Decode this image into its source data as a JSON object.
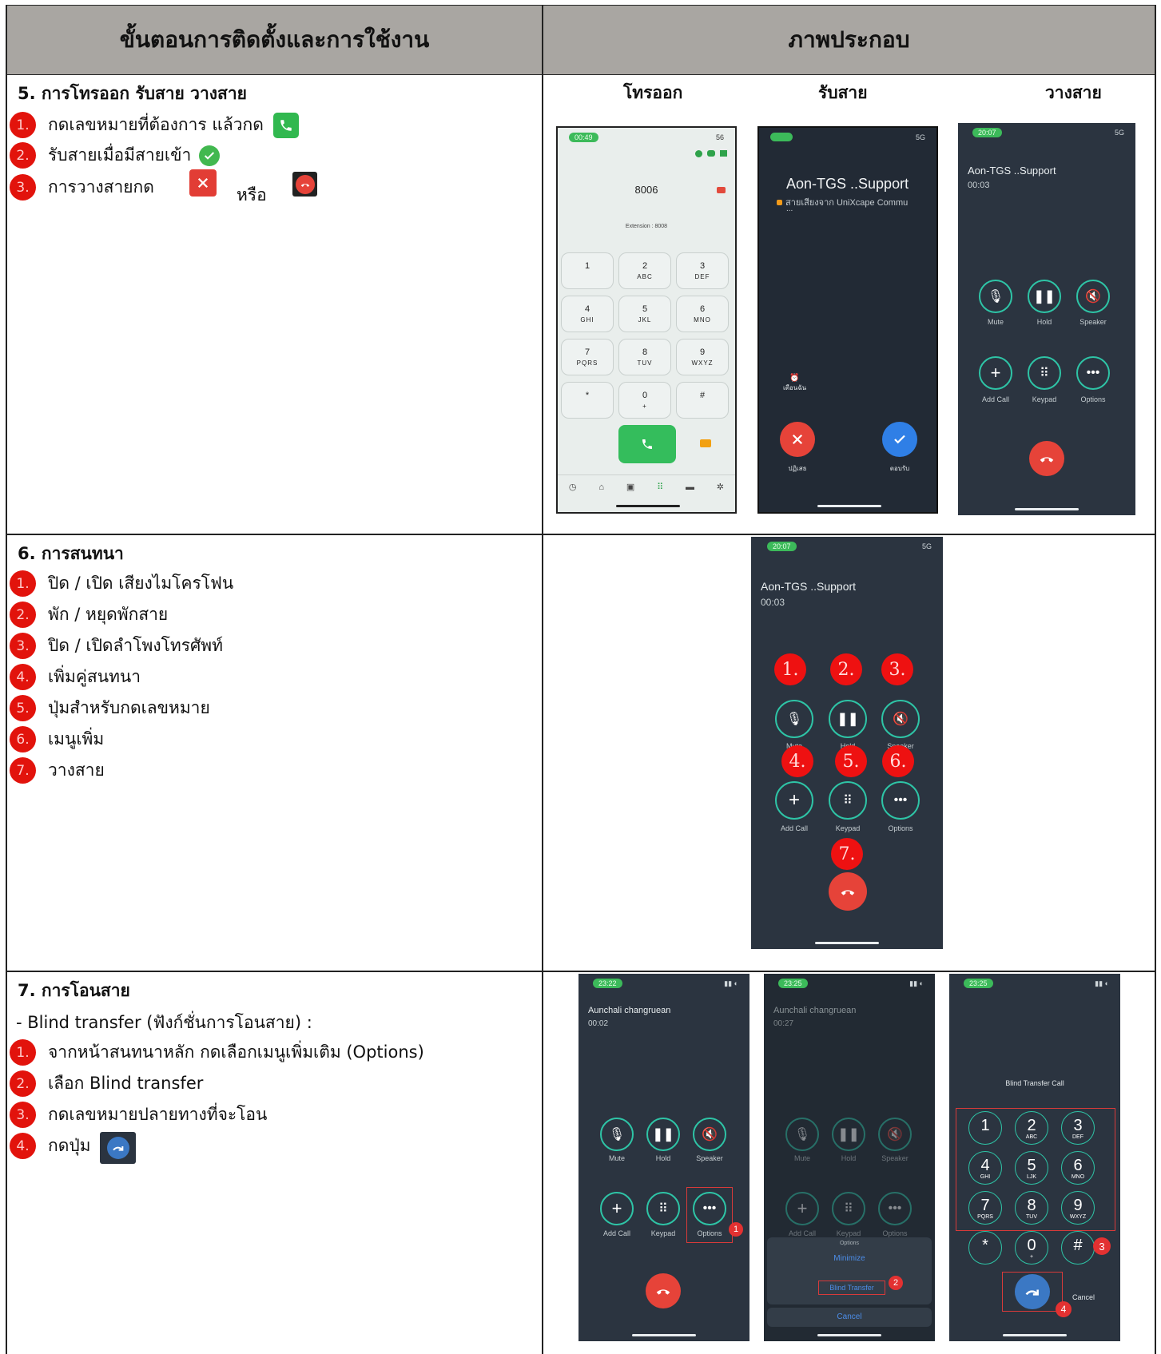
{
  "header": {
    "left": "ขั้นตอนการติดตั้งและการใช้งาน",
    "right": "ภาพประกอบ"
  },
  "section5": {
    "title": "5. การโทรออก รับสาย วางสาย",
    "steps": [
      "กดเลขหมายที่ต้องการ แล้วกด",
      "รับสายเมื่อมีสายเข้า",
      "การวางสายกด"
    ],
    "or": "หรือ",
    "nums": [
      "1.",
      "2.",
      "3."
    ],
    "captions": [
      "โทรออก",
      "รับสาย",
      "วางสาย"
    ],
    "dialer": {
      "time": "00:49",
      "signal": "56",
      "number": "8006",
      "extension": "Extension : 8008",
      "keys": [
        {
          "d": "1",
          "l": ""
        },
        {
          "d": "2",
          "l": "ABC"
        },
        {
          "d": "3",
          "l": "DEF"
        },
        {
          "d": "4",
          "l": "GHI"
        },
        {
          "d": "5",
          "l": "JKL"
        },
        {
          "d": "6",
          "l": "MNO"
        },
        {
          "d": "7",
          "l": "PQRS"
        },
        {
          "d": "8",
          "l": "TUV"
        },
        {
          "d": "9",
          "l": "WXYZ"
        },
        {
          "d": "*",
          "l": ""
        },
        {
          "d": "0",
          "l": "+"
        },
        {
          "d": "#",
          "l": ""
        }
      ]
    },
    "incoming": {
      "signal": "5G",
      "name": "Aon-TGS ..Support",
      "sub": "สายเสียงจาก UniXcape Commu",
      "sub2": "...",
      "remind": "เตือนฉัน",
      "decline": "ปฏิเสธ",
      "accept": "ตอบรับ"
    },
    "incall": {
      "time": "20:07",
      "signal": "5G",
      "name": "Aon-TGS ..Support",
      "duration": "00:03",
      "labels": [
        "Mute",
        "Hold",
        "Speaker",
        "Add Call",
        "Keypad",
        "Options"
      ]
    }
  },
  "section6": {
    "title": "6.  การสนทนา",
    "steps": [
      "ปิด / เปิด เสียงไมโครโฟน",
      "พัก / หยุดพักสาย",
      "ปิด  / เปิดลำโพงโทรศัพท์",
      "เพิ่มคู่สนทนา",
      "ปุ่มสำหรับกดเลขหมาย",
      "เมนูเพิ่ม",
      "วางสาย"
    ],
    "nums": [
      "1.",
      "2.",
      "3.",
      "4.",
      "5.",
      "6.",
      "7."
    ],
    "phone": {
      "time": "20:07",
      "signal": "5G",
      "name": "Aon-TGS ..Support",
      "duration": "00:03",
      "labels": [
        "Mute",
        "Hold",
        "Speaker",
        "Add Call",
        "Keypad",
        "Options"
      ]
    }
  },
  "section7": {
    "title": "7.  การโอนสาย",
    "intro": "- Blind transfer (ฟังก์ชั่นการโอนสาย) :",
    "steps": [
      "จากหน้าสนทนาหลัก กดเลือกเมนูเพิ่มเติม (Options)",
      "เลือก Blind transfer",
      "กดเลขหมายปลายทางที่จะโอน",
      "กดปุ่ม"
    ],
    "nums": [
      "1.",
      "2.",
      "3.",
      "4."
    ],
    "phoneA": {
      "time": "23:22",
      "name": "Aunchali changruean",
      "duration": "00:02",
      "labels": [
        "Mute",
        "Hold",
        "Speaker",
        "Add Call",
        "Keypad",
        "Options"
      ]
    },
    "phoneB": {
      "time": "23:25",
      "name": "Aunchali changruean",
      "duration": "00:27",
      "labels": [
        "Mute",
        "Hold",
        "Speaker",
        "Add Call",
        "Keypad",
        "Options"
      ],
      "menu_title": "Options",
      "minimize": "Minimize",
      "blind": "Blind Transfer",
      "cancel": "Cancel"
    },
    "phoneC": {
      "time": "23:25",
      "title": "Blind Transfer Call",
      "keys": [
        {
          "d": "1",
          "l": ""
        },
        {
          "d": "2",
          "l": "ABC"
        },
        {
          "d": "3",
          "l": "DEF"
        },
        {
          "d": "4",
          "l": "GHI"
        },
        {
          "d": "5",
          "l": "LJK"
        },
        {
          "d": "6",
          "l": "MNO"
        },
        {
          "d": "7",
          "l": "PQRS"
        },
        {
          "d": "8",
          "l": "TUV"
        },
        {
          "d": "9",
          "l": "WXYZ"
        },
        {
          "d": "*",
          "l": ""
        },
        {
          "d": "0",
          "l": "+"
        },
        {
          "d": "#",
          "l": ""
        }
      ],
      "cancel": "Cancel"
    },
    "badges": [
      "1",
      "2",
      "3",
      "4"
    ]
  },
  "colors": {
    "header_bg": "#a9a6a2",
    "step_num": "#e2130c",
    "phone_dark": "#2b3440",
    "accent_teal": "#2ec4a6",
    "hangup_red": "#e64339",
    "answer_green": "#3cba5a",
    "accept_blue": "#2f7fe6",
    "transfer_blue": "#3b78c4"
  }
}
